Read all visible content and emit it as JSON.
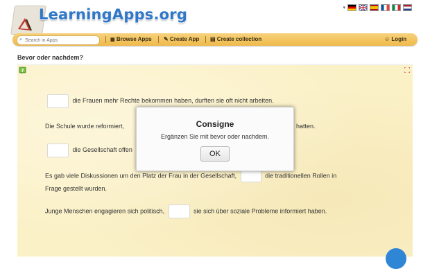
{
  "header": {
    "logo_text": "LearningApps.org"
  },
  "languages": [
    {
      "code": "de",
      "colors": [
        "#000000",
        "#dd0000",
        "#ffce00"
      ]
    },
    {
      "code": "en",
      "colors": [
        "#012169",
        "#ffffff",
        "#c8102e"
      ]
    },
    {
      "code": "es",
      "colors": [
        "#aa151b",
        "#f1bf00",
        "#aa151b"
      ]
    },
    {
      "code": "fr",
      "colors": [
        "#0055a4",
        "#ffffff",
        "#ef4135"
      ]
    },
    {
      "code": "it",
      "colors": [
        "#009246",
        "#ffffff",
        "#ce2b37"
      ]
    },
    {
      "code": "nl",
      "colors": [
        "#ae1c28",
        "#ffffff",
        "#21468b"
      ]
    }
  ],
  "navbar": {
    "search_placeholder": "Search in Apps",
    "browse": "Browse Apps",
    "create": "Create App",
    "collection": "Create collection",
    "login": "Login"
  },
  "page": {
    "title": "Bevor oder nachdem?"
  },
  "exercise": {
    "sentence1": "die Frauen mehr Rechte bekommen haben, durften sie oft nicht arbeiten.",
    "sentence2_before": "Die Schule wurde reformiert,",
    "sentence2_after": "hatten.",
    "sentence3": "die Gesellschaft offen",
    "sentence4_a": "Es gab viele Diskussionen um den Platz der Frau in der Gesellschaft,",
    "sentence4_b": "die traditionellen Rollen in",
    "sentence4_c": "Frage gestellt wurden.",
    "sentence5_a": "Junge Menschen engagieren sich politisch,",
    "sentence5_b": "sie sich über soziale Probleme informiert haben."
  },
  "modal": {
    "title": "Consigne",
    "message": "Ergänzen Sie mit bevor oder nachdem.",
    "ok": "OK"
  },
  "colors": {
    "accent_blue": "#2e77c9",
    "nav_yellow": "#f0b94a",
    "app_background": "#fbf1c7"
  }
}
